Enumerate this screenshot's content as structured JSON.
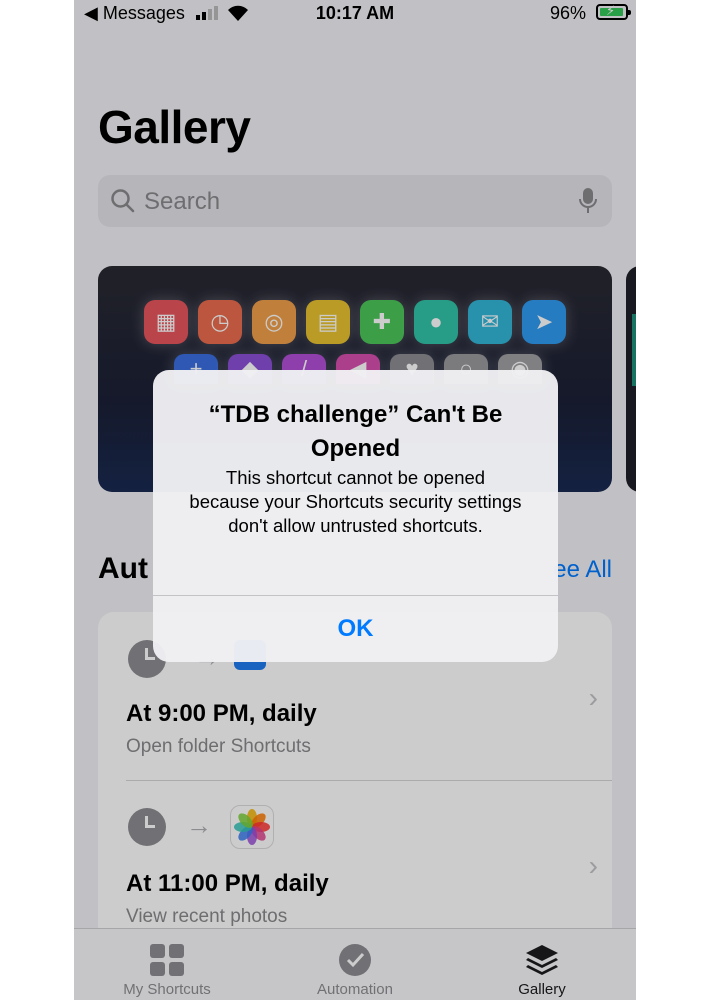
{
  "status_bar": {
    "back_label": "◀ Messages",
    "time": "10:17 AM",
    "battery_percent": "96%",
    "battery_level": 0.96,
    "battery_color": "#34c759"
  },
  "page": {
    "title": "Gallery",
    "search_placeholder": "Search"
  },
  "featured_card": {
    "icons_row1": [
      {
        "icon": "calendar-plus-icon",
        "color": "#e8555d"
      },
      {
        "icon": "timer-icon",
        "color": "#ec6c4e"
      },
      {
        "icon": "airdrop-icon",
        "color": "#f0a04b"
      },
      {
        "icon": "note-plus-icon",
        "color": "#e9c230"
      },
      {
        "icon": "message-plus-icon",
        "color": "#4cc75a"
      },
      {
        "icon": "chat-bubble-icon",
        "color": "#31c3a8"
      },
      {
        "icon": "mail-icon",
        "color": "#33b6d8"
      },
      {
        "icon": "location-arrow-icon",
        "color": "#2f9bf0"
      }
    ],
    "icons_row2": [
      {
        "icon": "plus-icon",
        "color": "#3a6fe0"
      },
      {
        "icon": "shape-icon",
        "color": "#8b4fd8"
      },
      {
        "icon": "slash-icon",
        "color": "#b24fd8"
      },
      {
        "icon": "megaphone-icon",
        "color": "#d84fb0"
      },
      {
        "icon": "heart-icon",
        "color": "#8e8e93"
      },
      {
        "icon": "circle-icon",
        "color": "#9a9a9e"
      },
      {
        "icon": "people-icon",
        "color": "#a0a0a4"
      }
    ]
  },
  "automations": {
    "section_title": "Aut",
    "see_all": "ee All",
    "items": [
      {
        "time": "At 9:00 PM, daily",
        "subtitle": "Open folder Shortcuts"
      },
      {
        "time": "At 11:00 PM, daily",
        "subtitle": "View recent photos"
      }
    ]
  },
  "tab_bar": {
    "tabs": [
      {
        "label": "My Shortcuts",
        "icon": "grid-icon"
      },
      {
        "label": "Automation",
        "icon": "clock-check-icon"
      },
      {
        "label": "Gallery",
        "icon": "layers-icon"
      }
    ]
  },
  "alert": {
    "title": "“TDB challenge” Can't Be Opened",
    "message": "This shortcut cannot be opened because your Shortcuts security settings don't allow untrusted shortcuts.",
    "ok_label": "OK",
    "accent_color": "#007aff"
  }
}
